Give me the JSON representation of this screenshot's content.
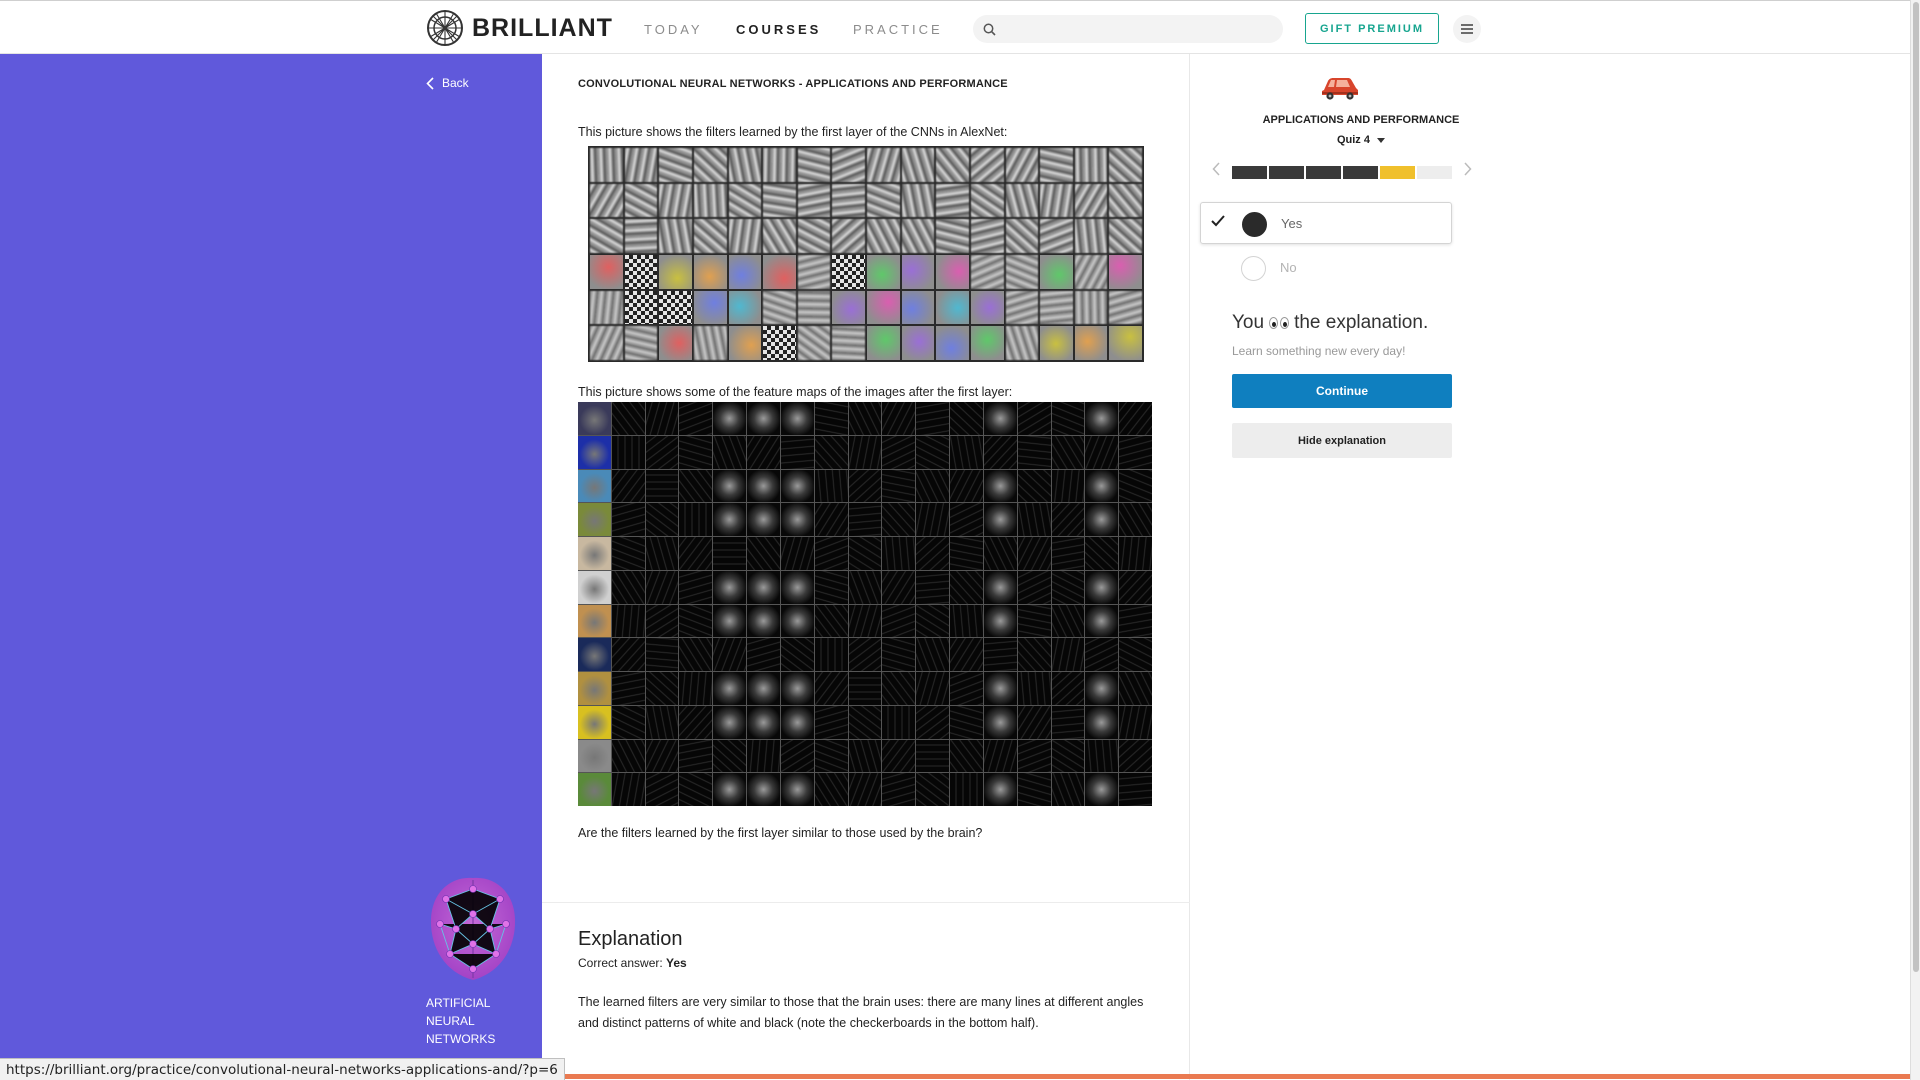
{
  "header": {
    "brand": "BRILLIANT",
    "nav": [
      {
        "label": "TODAY"
      },
      {
        "label": "COURSES"
      },
      {
        "label": "PRACTICE"
      }
    ],
    "search": {
      "placeholder": "",
      "value": ""
    },
    "gift_label": "GIFT PREMIUM"
  },
  "sidebar": {
    "back_label": "Back",
    "course_lines": [
      "ARTIFICIAL",
      "NEURAL",
      "NETWORKS"
    ]
  },
  "main": {
    "section_title": "CONVOLUTIONAL NEURAL NETWORKS - APPLICATIONS AND PERFORMANCE",
    "filters_caption": "This picture shows the filters learned by the first layer of the CNNs in AlexNet:",
    "fmaps_caption": "This picture shows some of the feature maps of the images after the first layer:",
    "question": "Are the filters learned by the first layer similar to those used by the brain?",
    "explanation": {
      "heading": "Explanation",
      "answer_prefix": "Correct answer: ",
      "answer_value": "Yes",
      "text": "The learned filters are very similar to those that the brain uses: there are many lines at different angles and distinct patterns of white and black (note the checkerboards in the bottom half)."
    }
  },
  "quiz": {
    "title": "APPLICATIONS AND PERFORMANCE",
    "number_label": "Quiz 4",
    "progress": {
      "total": 6,
      "completed": 4,
      "current": 5
    },
    "options": [
      {
        "label": "Yes",
        "selected": true
      },
      {
        "label": "No",
        "selected": false
      }
    ],
    "you_prefix": "You",
    "you_suffix": "the explanation.",
    "learn_line": "Learn something new every day!",
    "continue_label": "Continue",
    "hide_label": "Hide explanation"
  },
  "status_bar": {
    "url": "https://brilliant.org/practice/convolutional-neural-networks-applications-and/?p=6"
  },
  "colors": {
    "sidebar_bg": "#6059db",
    "accent_teal": "#17a58f",
    "continue_blue": "#0f7fbf",
    "progress_current": "#f0c02c",
    "bottom_bar": "#ea7a51"
  },
  "icons": [
    "brilliant-logo-icon",
    "search-icon",
    "menu-icon",
    "chevron-left-icon",
    "chevron-right-icon",
    "check-icon",
    "car-icon",
    "brain-icon"
  ]
}
